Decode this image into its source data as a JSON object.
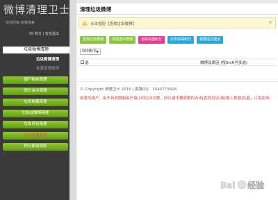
{
  "sidebar": {
    "logo": "微博清理卫士",
    "welcome": "欢迎回来   玫瑰悦美",
    "points": "50 积分 | 安全退出",
    "active_item": "垃圾微博清理",
    "sub_items": [
      "垃圾微博清理",
      "批量管理微博"
    ],
    "menu": [
      {
        "label": "僵尸粉丝清理",
        "highlight": false
      },
      {
        "label": "死亡关注清理",
        "highlight": false
      },
      {
        "label": "垃圾收藏清理",
        "highlight": false
      },
      {
        "label": "垃圾@微博清理",
        "highlight": false
      },
      {
        "label": "垃圾评论清理",
        "highlight": false
      },
      {
        "label": "积分免费充值",
        "highlight": true
      },
      {
        "label": "积分使用规则",
        "highlight": false
      }
    ]
  },
  "main": {
    "title": "清理垃圾微博",
    "notice": "点击按钮【查找垃圾微博】",
    "notice_close": "×",
    "toolbar": [
      {
        "label": "查找垃圾微博",
        "color": "#8dc63f"
      },
      {
        "label": "清理选中微博",
        "color": "#8dc63f"
      },
      {
        "label": "自助充值积分",
        "color": "#e63d8f"
      },
      {
        "label": "分享获得积分",
        "color": "#2ea7e0"
      },
      {
        "label": "我要提交建议",
        "color": "#2ea7e0"
      }
    ],
    "page_size": "500条/页",
    "table": {
      "select_col": "选",
      "content_col": "微博及原因 (按Shift可多选)"
    },
    "copyright": "© Copyright 清理卫士 2016 | 客服QQ：1544773418",
    "tip": "亲爱的用户，由于新浪限制用户每小时访问次数，所以请不要频繁的点击[查找垃圾]或[载入数据]功能，以免影响"
  },
  "colors": {
    "sidebar_bg": "#3a3a3a",
    "green": "#78b42a",
    "tip_red": "#e23b3b"
  },
  "watermark": "Bai度经验",
  "watermark_url": "jingyan.baidu.com"
}
